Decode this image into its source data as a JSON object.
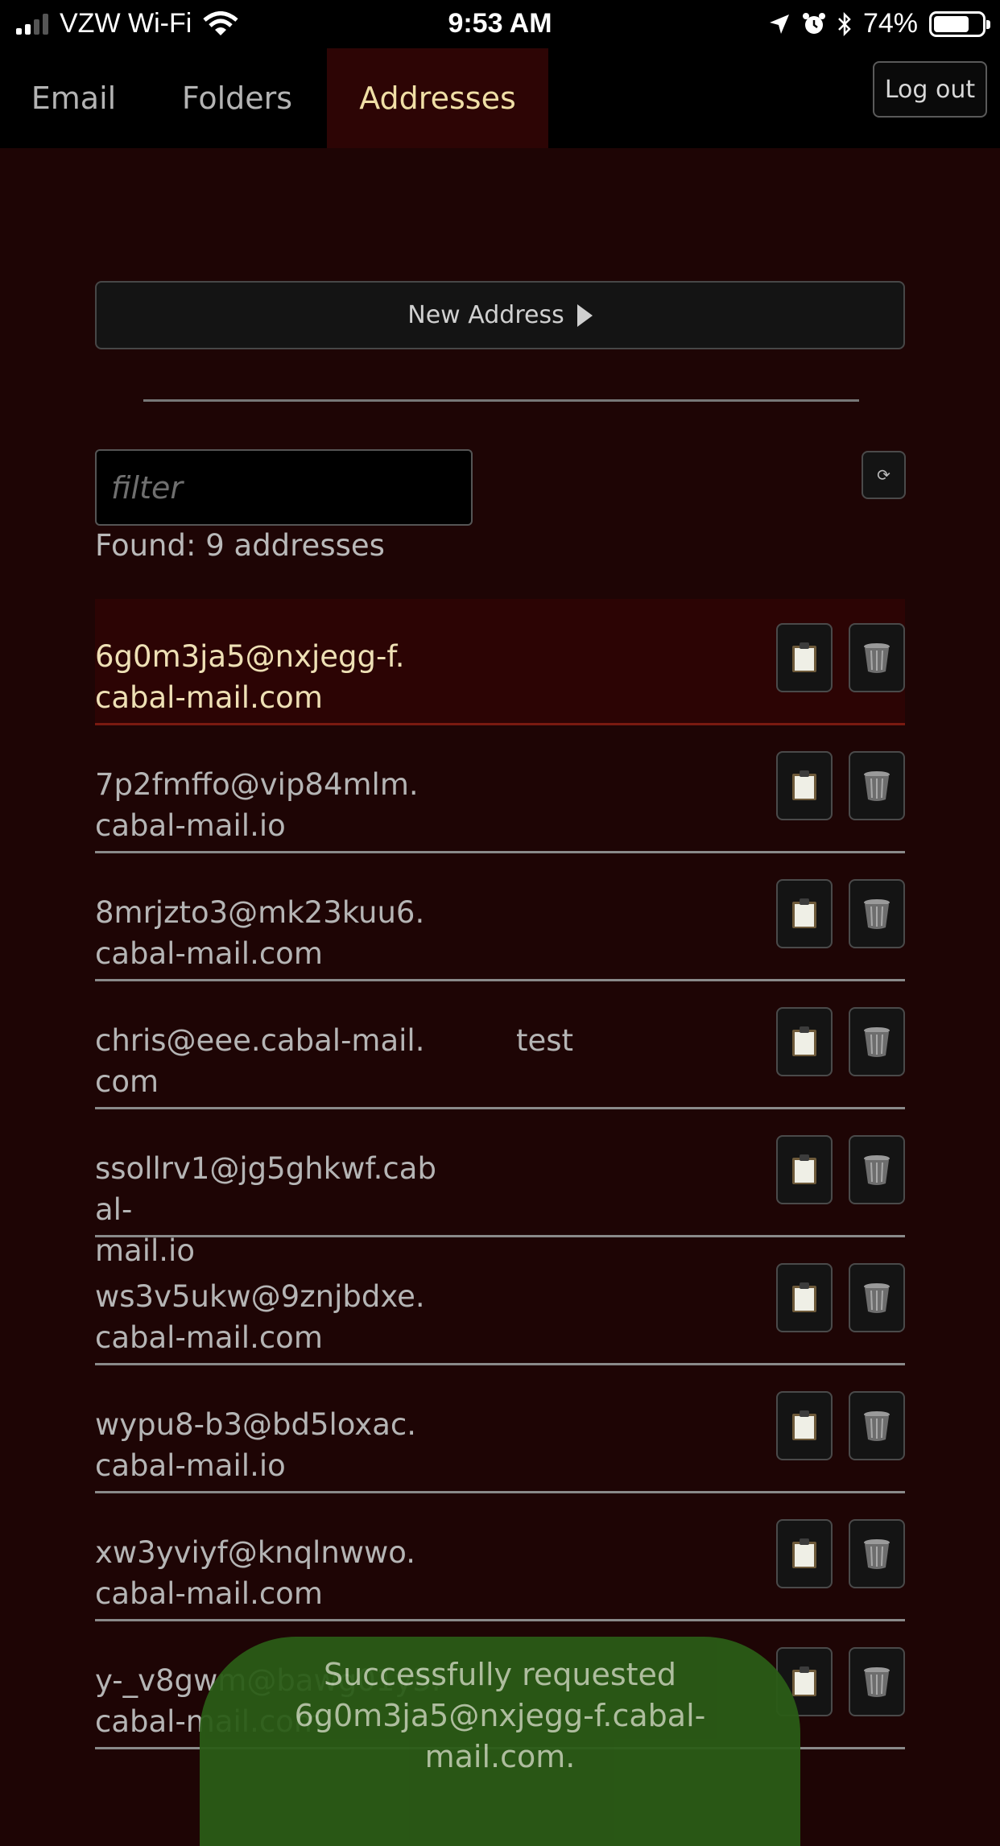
{
  "status_bar": {
    "carrier": "VZW Wi-Fi",
    "time": "9:53 AM",
    "battery": "74%",
    "battery_level": 0.74
  },
  "nav": {
    "tabs": [
      {
        "label": "Email",
        "active": false
      },
      {
        "label": "Folders",
        "active": false
      },
      {
        "label": "Addresses",
        "active": true
      }
    ],
    "logout_label": "Log out"
  },
  "toolbar": {
    "new_address_label": "New Address",
    "filter_placeholder": "filter",
    "refresh_icon": "⟳",
    "found_text": "Found: 9 addresses"
  },
  "addresses": [
    {
      "address": "6g0m3ja5@nxjegg-f.cabal-mail.com",
      "line1": "6g0m3ja5@nxjegg-f.",
      "line2": "cabal-mail.com",
      "comment": "",
      "selected": true
    },
    {
      "address": "7p2fmffo@vip84mlm.cabal-mail.io",
      "line1": "7p2fmffo@vip84mlm.",
      "line2": "cabal-mail.io",
      "comment": "",
      "selected": false
    },
    {
      "address": "8mrjzto3@mk23kuu6.cabal-mail.com",
      "line1": "8mrjzto3@mk23kuu6.",
      "line2": "cabal-mail.com",
      "comment": "",
      "selected": false
    },
    {
      "address": "chris@eee.cabal-mail.com",
      "line1": "chris@eee.cabal-mail.",
      "line2": "com",
      "comment": "test",
      "selected": false
    },
    {
      "address": "ssollrv1@jg5ghkwf.cabal-mail.io",
      "line1": "ssollrv1@jg5ghkwf.cabal-",
      "line2": "mail.io",
      "comment": "",
      "selected": false
    },
    {
      "address": "ws3v5ukw@9znjbdxe.cabal-mail.com",
      "line1": "ws3v5ukw@9znjbdxe.",
      "line2": "cabal-mail.com",
      "comment": "",
      "selected": false
    },
    {
      "address": "wypu8-b3@bd5loxac.cabal-mail.io",
      "line1": "wypu8-b3@bd5loxac.",
      "line2": "cabal-mail.io",
      "comment": "",
      "selected": false
    },
    {
      "address": "xw3yviyf@knqlnwwo.cabal-mail.com",
      "line1": "xw3yviyf@knqlnwwo.",
      "line2": "cabal-mail.com",
      "comment": "",
      "selected": false
    },
    {
      "address": "y-_v8gwm@bawg01y5.cabal-mail.com",
      "line1": "y-_v8gwm@bawg01y5.",
      "line2": "cabal-mail.com",
      "comment": "",
      "selected": false
    }
  ],
  "toast": {
    "line1": "Successfully requested",
    "line2": "6g0m3ja5@nxjegg-f.cabal-",
    "line3": "mail.com."
  },
  "icons": {
    "copy": "clipboard-icon",
    "delete": "trash-icon"
  },
  "colors": {
    "background": "#1e0505",
    "active_tab": "#2d0505",
    "accent_text": "#f0dfa6",
    "toast": "#2a5c16"
  }
}
